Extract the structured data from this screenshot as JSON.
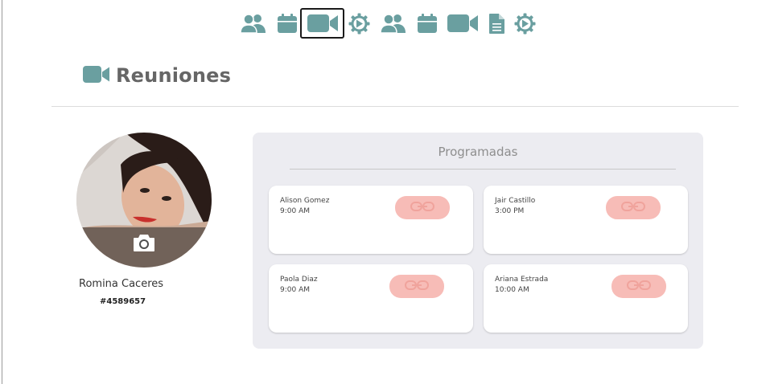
{
  "nav": {
    "items": [
      {
        "icon": "users-icon",
        "active": false
      },
      {
        "icon": "calendar-icon",
        "active": false
      },
      {
        "icon": "video-camera-icon",
        "active": true
      },
      {
        "icon": "gear-icon",
        "active": false
      },
      {
        "icon": "users-icon",
        "active": false
      },
      {
        "icon": "calendar-icon",
        "active": false
      },
      {
        "icon": "video-camera-icon",
        "active": false
      },
      {
        "icon": "document-icon",
        "active": false
      },
      {
        "icon": "gear-icon",
        "active": false
      }
    ]
  },
  "page": {
    "title": "Reuniones",
    "title_icon": "video-camera-icon"
  },
  "profile": {
    "name": "Romina Caceres",
    "id": "#4589657",
    "overlay_icon": "camera-icon"
  },
  "meetings": {
    "heading": "Programadas",
    "items": [
      {
        "name": "Alison Gomez",
        "time": "9:00 AM",
        "action_icon": "link-icon"
      },
      {
        "name": "Jair Castillo",
        "time": "3:00 PM",
        "action_icon": "link-icon"
      },
      {
        "name": "Paola Diaz",
        "time": "9:00 AM",
        "action_icon": "link-icon"
      },
      {
        "name": "Ariana Estrada",
        "time": "10:00 AM",
        "action_icon": "link-icon"
      }
    ]
  },
  "colors": {
    "accent": "#6a9fa0",
    "link_button": "#f7bcb7",
    "panel_bg": "#ececf1"
  }
}
